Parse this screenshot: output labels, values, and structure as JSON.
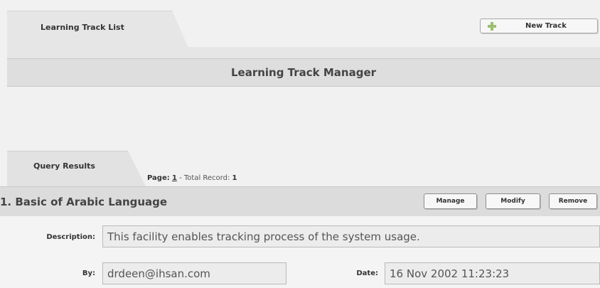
{
  "top_tab": {
    "label": "Learning Track List"
  },
  "toolbar": {
    "new_track_label": "New Track"
  },
  "manager": {
    "title": "Learning Track Manager"
  },
  "results": {
    "tab_label": "Query Results",
    "page_label": "Page:",
    "page_number": "1",
    "separator": " - Total Record: ",
    "total_records": "1"
  },
  "record": {
    "title": "1. Basic of Arabic Language",
    "buttons": {
      "manage": "Manage",
      "modify": "Modify",
      "remove": "Remove"
    },
    "description_label": "Description:",
    "description": "This facility enables tracking process of the system usage.",
    "by_label": "By:",
    "by": "drdeen@ihsan.com",
    "date_label": "Date:",
    "date": "16 Nov 2002 11:23:23"
  }
}
